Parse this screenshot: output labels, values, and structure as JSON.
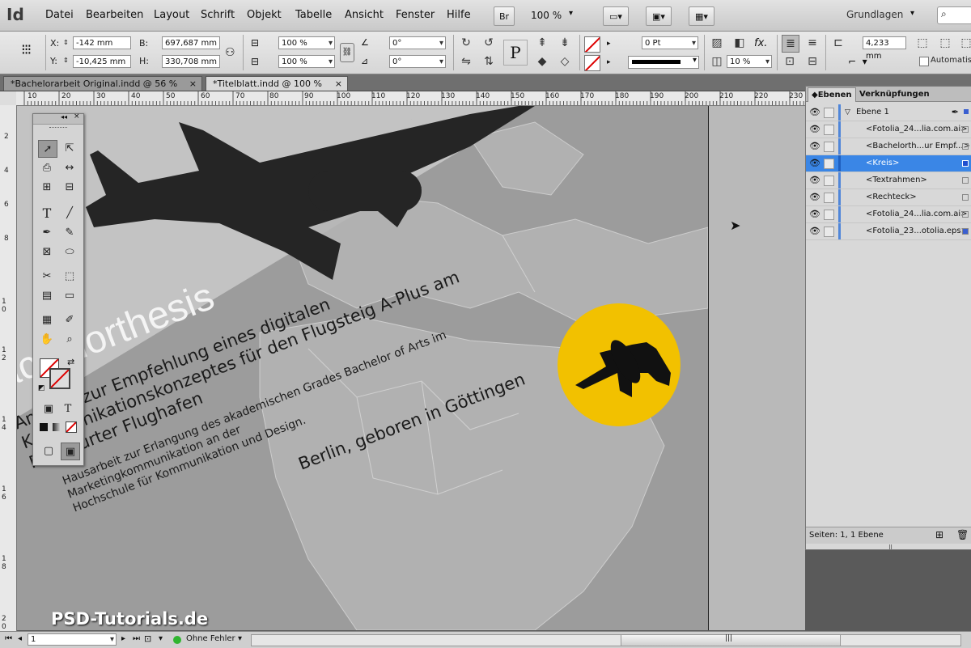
{
  "app": {
    "logo": "Id"
  },
  "menu": [
    "Datei",
    "Bearbeiten",
    "Layout",
    "Schrift",
    "Objekt",
    "Tabelle",
    "Ansicht",
    "Fenster",
    "Hilfe"
  ],
  "toolbar_top": {
    "bridge_label": "Br",
    "zoom": "100 %",
    "workspace": "Grundlagen"
  },
  "control": {
    "x_label": "X:",
    "x_value": "-142 mm",
    "y_label": "Y:",
    "y_value": "-10,425 mm",
    "w_label": "B:",
    "w_value": "697,687 mm",
    "h_label": "H:",
    "h_value": "330,708 mm",
    "scale_x": "100 %",
    "scale_y": "100 %",
    "rotate": "0°",
    "shear": "0°",
    "stroke_weight": "0 Pt",
    "opacity": "10 %",
    "offset": "4,233 mm",
    "auto_label": "Automatisc"
  },
  "tabs": [
    {
      "label": "*Bachelorarbeit Original.indd @ 56 %",
      "close": "×"
    },
    {
      "label": "*Titelblatt.indd @ 100 %",
      "close": "×"
    }
  ],
  "ruler_h": [
    "10",
    "20",
    "30",
    "40",
    "50",
    "60",
    "70",
    "80",
    "90",
    "100",
    "110",
    "120",
    "130",
    "140",
    "150",
    "160",
    "170",
    "180",
    "190",
    "200",
    "210",
    "220",
    "230"
  ],
  "ruler_v": [
    "2",
    "4",
    "6",
    "8",
    "1 0",
    "1 2",
    "1 4",
    "1 6",
    "1 8",
    "2 0"
  ],
  "document": {
    "title": "Bachelorthesis",
    "subtitle": [
      "Analyse zur Empfehlung eines digitalen",
      "Kommunikationskonzeptes für den Flugsteig A-Plus am",
      "Frankfurter Flughafen"
    ],
    "body": [
      "Hausarbeit zur Erlangung des akademischen Grades Bachelor of Arts im",
      "Marketingkommunikation an der",
      "Hochschule für Kommunikation und Design."
    ],
    "author_line": "Berlin, geboren in Göttingen",
    "circle_color": "#f2c100"
  },
  "watermark": "PSD-Tutorials.de",
  "layers_panel": {
    "tab_layers": "Ebenen",
    "tab_links": "Verknüpfungen",
    "layer_name": "Ebene 1",
    "items": [
      "<Fotolia_24...lia.com.ai>",
      "<Bachelorth...ur Empf...>",
      "<Kreis>",
      "<Textrahmen>",
      "<Rechteck>",
      "<Fotolia_24...lia.com.ai>",
      "<Fotolia_23...otolia.eps>"
    ],
    "selected_index": 2,
    "footer": "Seiten: 1, 1 Ebene"
  },
  "status": {
    "page": "1",
    "errors": "Ohne Fehler"
  },
  "colors": {
    "selection": "#3a86e6",
    "accent_yellow": "#f2c100"
  }
}
